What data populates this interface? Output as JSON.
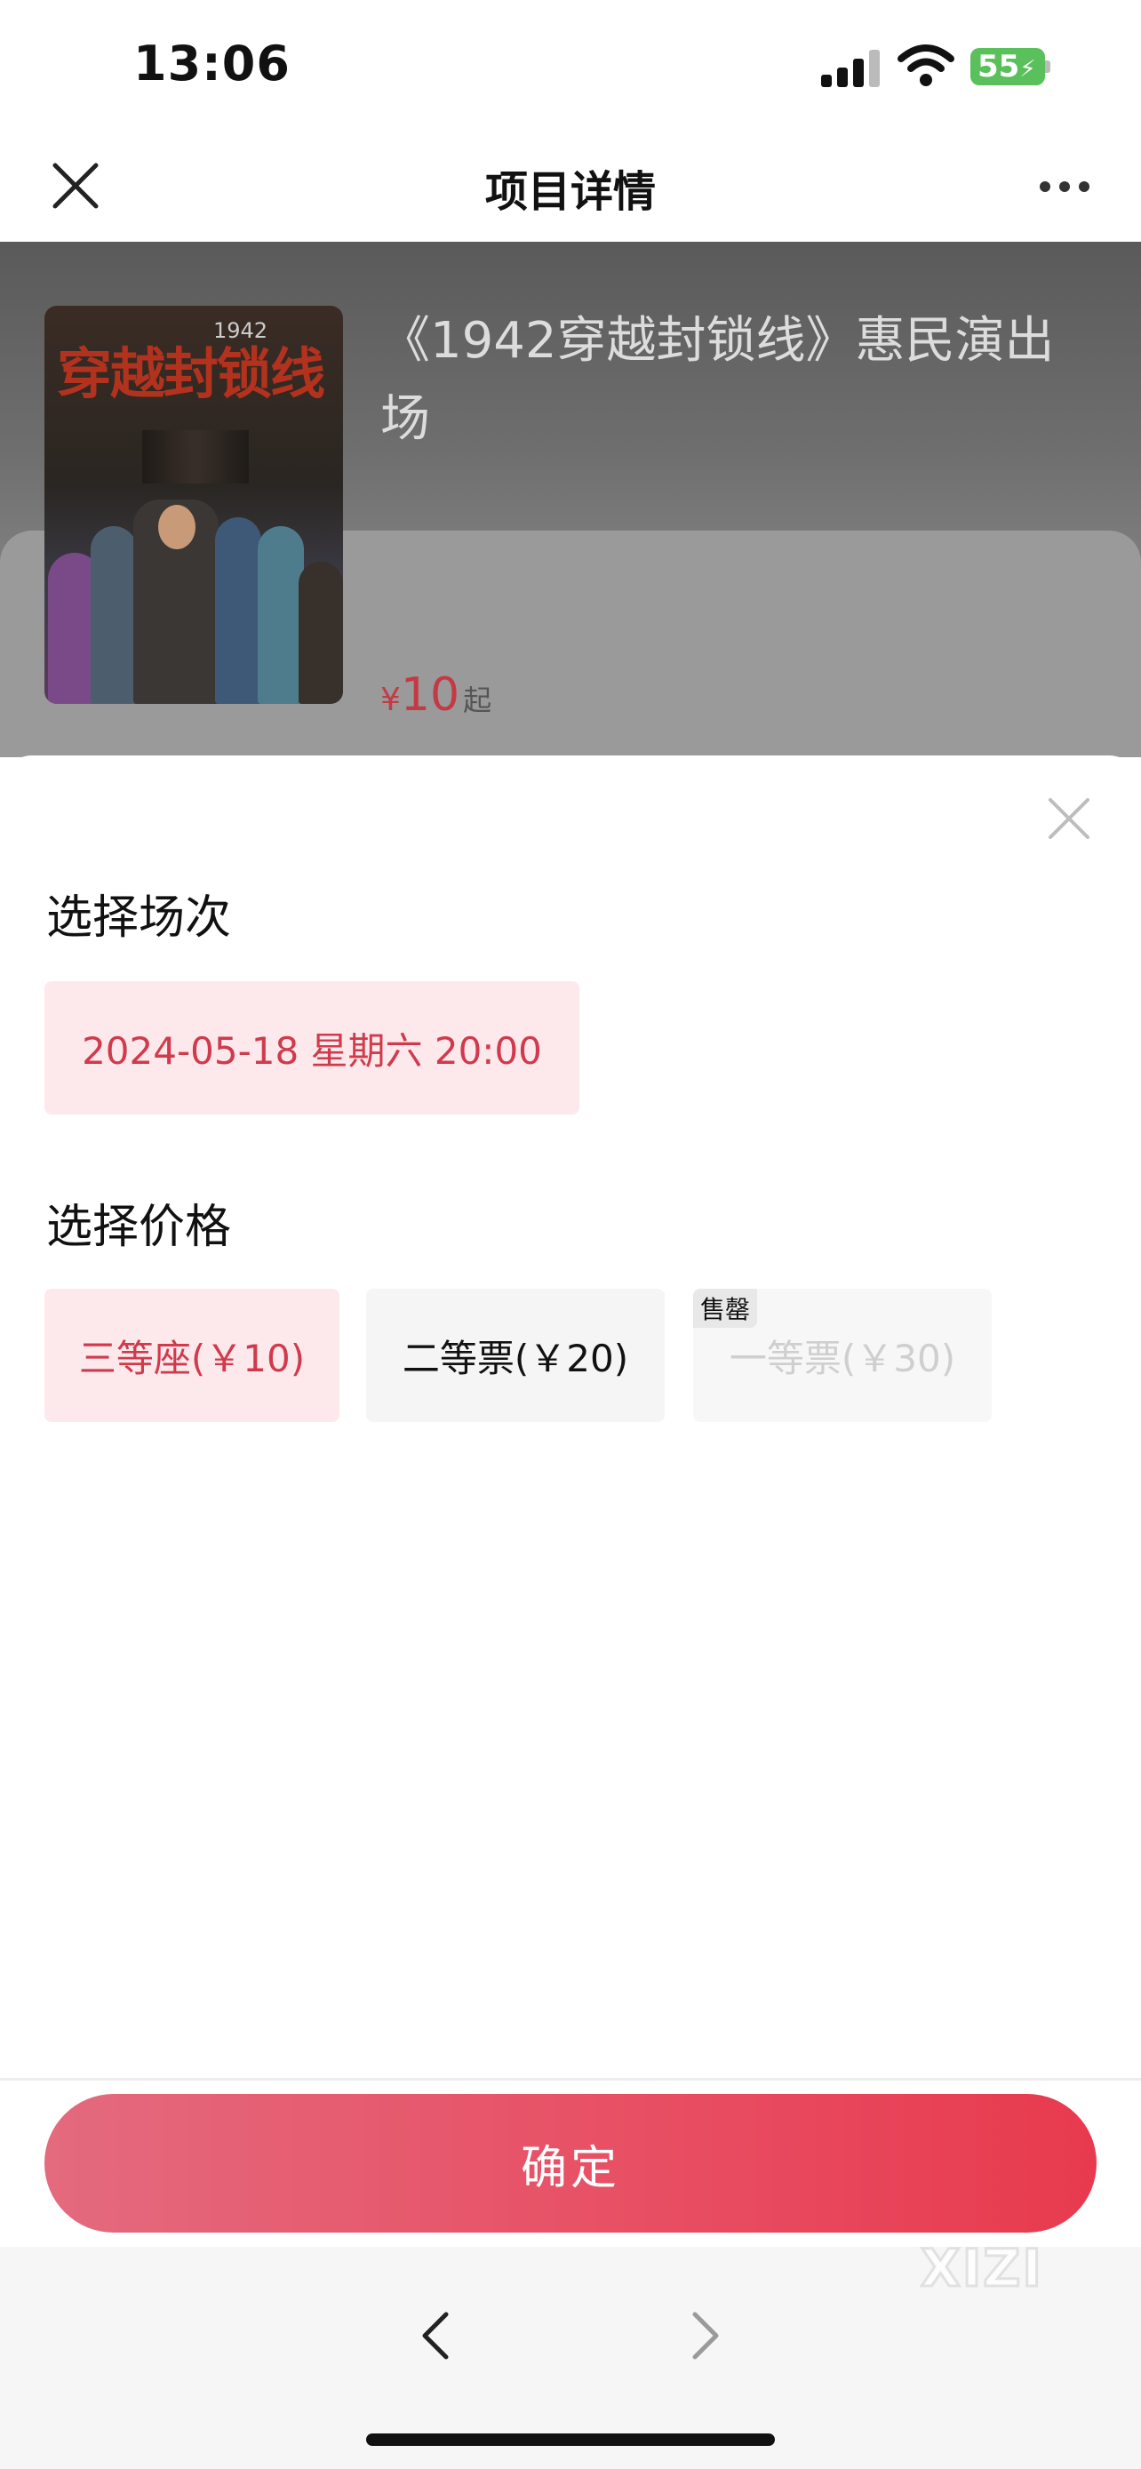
{
  "status_bar": {
    "time": "13:06",
    "battery": "55"
  },
  "nav": {
    "title": "项目详情"
  },
  "show": {
    "title": "《1942穿越封锁线》惠民演出场",
    "poster_title": "穿越封锁线",
    "poster_year": "1942",
    "price_symbol": "¥",
    "price_value": "10",
    "price_suffix": "起"
  },
  "session": {
    "heading": "选择场次",
    "options": [
      {
        "label": "2024-05-18 星期六 20:00",
        "selected": true
      }
    ]
  },
  "price": {
    "heading": "选择价格",
    "options": [
      {
        "label": "三等座(￥10)",
        "state": "selected"
      },
      {
        "label": "二等票(￥20)",
        "state": "normal"
      },
      {
        "label": "一等票(￥30)",
        "state": "sold-out",
        "tag": "售罄"
      }
    ]
  },
  "confirm_label": "确定",
  "watermark": "XIZI",
  "colors": {
    "accent": "#d03a4c",
    "selected_bg": "#fde9ec",
    "button_start": "#e46a7e",
    "button_end": "#e83a4e"
  }
}
